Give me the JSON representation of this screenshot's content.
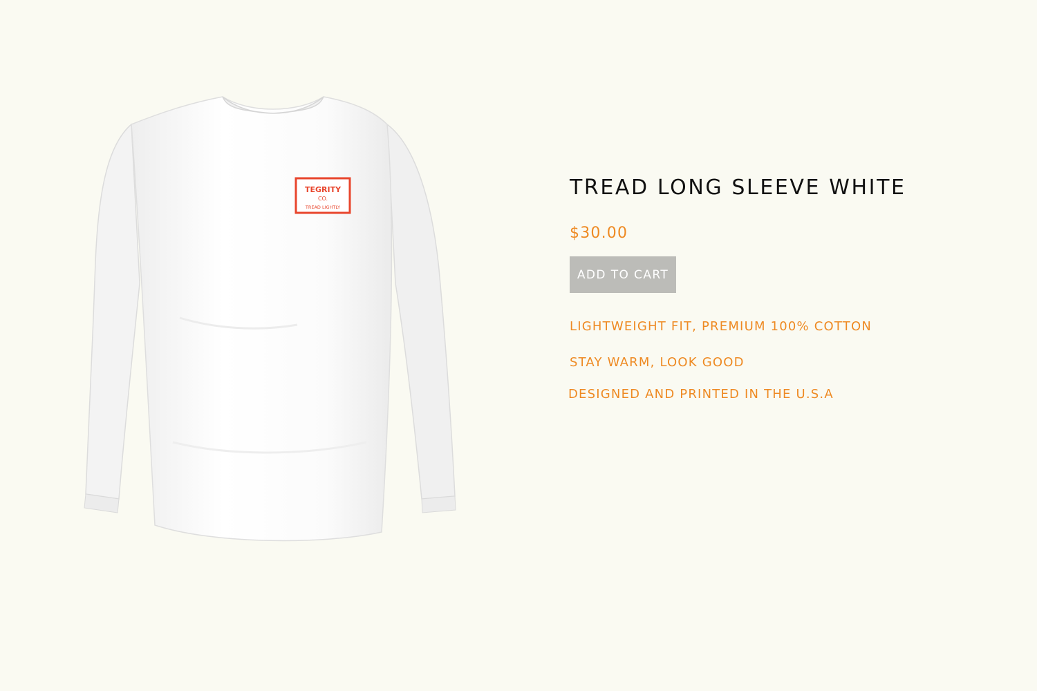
{
  "product": {
    "title": "TREAD LONG SLEEVE WHITE",
    "price": "$30.00",
    "add_to_cart_label": "ADD TO CART",
    "features": [
      "LIGHTWEIGHT FIT, PREMIUM 100% COTTON",
      "STAY WARM, LOOK GOOD",
      "DESIGNED AND PRINTED IN THE U.S.A"
    ],
    "logo": {
      "line1": "TEGRITY",
      "line2": "CO.",
      "line3": "TREAD LIGHTLY"
    }
  },
  "colors": {
    "background": "#fafaf2",
    "accent": "#ee8a23",
    "button": "#bcbcb8",
    "title": "#111111",
    "logo_red": "#e8452c"
  }
}
